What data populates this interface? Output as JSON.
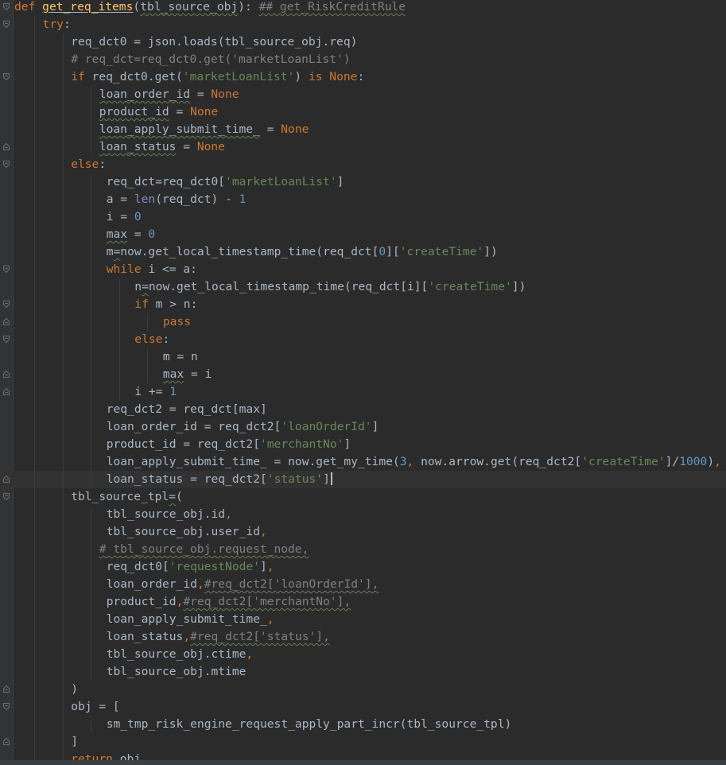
{
  "editor": {
    "language": "python",
    "colors": {
      "background": "#2b2b2b",
      "keyword": "#cc7832",
      "string": "#6a8759",
      "number": "#6897bb",
      "comment": "#808080",
      "function": "#ffc66d",
      "builtin": "#8888c6",
      "text": "#a9b7c6"
    },
    "current_line_index": 27,
    "lines": [
      {
        "indent": 0,
        "fold": "open",
        "tokens": [
          [
            "kw",
            "def "
          ],
          [
            "fn u",
            "get_req_items"
          ],
          [
            "txt",
            "("
          ],
          [
            "txt wavy",
            "tbl_source_obj"
          ],
          [
            "txt",
            "): "
          ],
          [
            "cmt wavy",
            "## get_RiskCreditRule"
          ]
        ]
      },
      {
        "indent": 1,
        "fold": "open",
        "tokens": [
          [
            "kw",
            "try"
          ],
          [
            "txt",
            ":"
          ]
        ]
      },
      {
        "indent": 2,
        "fold": "",
        "tokens": [
          [
            "txt",
            "req_dct0 = json.loads(tbl_source_obj.req)"
          ]
        ]
      },
      {
        "indent": 2,
        "fold": "",
        "tokens": [
          [
            "cmt",
            "# req_dct=req_dct0.get('marketLoanList')"
          ]
        ]
      },
      {
        "indent": 2,
        "fold": "open",
        "tokens": [
          [
            "kw",
            "if "
          ],
          [
            "txt",
            "req_dct0.get("
          ],
          [
            "str",
            "'marketLoanList'"
          ],
          [
            "txt",
            ") "
          ],
          [
            "kw",
            "is None"
          ],
          [
            "txt",
            ":"
          ]
        ]
      },
      {
        "indent": 3,
        "fold": "",
        "tokens": [
          [
            "txt wavy",
            "loan_order_id"
          ],
          [
            "txt",
            " = "
          ],
          [
            "kw",
            "None"
          ]
        ]
      },
      {
        "indent": 3,
        "fold": "",
        "tokens": [
          [
            "txt wavy",
            "product_id"
          ],
          [
            "txt",
            " = "
          ],
          [
            "kw",
            "None"
          ]
        ]
      },
      {
        "indent": 3,
        "fold": "",
        "tokens": [
          [
            "txt wavy",
            "loan_apply_submit_time_"
          ],
          [
            "txt",
            " = "
          ],
          [
            "kw",
            "None"
          ]
        ]
      },
      {
        "indent": 3,
        "fold": "end",
        "tokens": [
          [
            "txt wavy",
            "loan_status"
          ],
          [
            "txt",
            " = "
          ],
          [
            "kw",
            "None"
          ]
        ]
      },
      {
        "indent": 2,
        "fold": "open",
        "tokens": [
          [
            "kw",
            "else"
          ],
          [
            "txt",
            ":"
          ]
        ]
      },
      {
        "indent": 3.25,
        "fold": "",
        "tokens": [
          [
            "txt",
            "req_dct=req_dct0["
          ],
          [
            "str",
            "'marketLoanList'"
          ],
          [
            "txt",
            "]"
          ]
        ]
      },
      {
        "indent": 3.25,
        "fold": "",
        "tokens": [
          [
            "txt",
            "a = "
          ],
          [
            "bi",
            "len"
          ],
          [
            "txt",
            "(req_dct) - "
          ],
          [
            "num",
            "1"
          ]
        ]
      },
      {
        "indent": 3.25,
        "fold": "",
        "tokens": [
          [
            "txt",
            "i = "
          ],
          [
            "num",
            "0"
          ]
        ]
      },
      {
        "indent": 3.25,
        "fold": "",
        "tokens": [
          [
            "txt wavy",
            "max"
          ],
          [
            "txt",
            " = "
          ],
          [
            "num",
            "0"
          ]
        ]
      },
      {
        "indent": 3.25,
        "fold": "",
        "tokens": [
          [
            "txt",
            "m"
          ],
          [
            "txt wavy",
            "="
          ],
          [
            "txt",
            "now.get_local_timestamp_time(req_dct["
          ],
          [
            "num",
            "0"
          ],
          [
            "txt",
            "]["
          ],
          [
            "str",
            "'createTime'"
          ],
          [
            "txt",
            "])"
          ]
        ]
      },
      {
        "indent": 3.25,
        "fold": "open",
        "tokens": [
          [
            "kw",
            "while "
          ],
          [
            "txt",
            "i <= a:"
          ]
        ]
      },
      {
        "indent": 4.25,
        "fold": "",
        "tokens": [
          [
            "txt",
            "n"
          ],
          [
            "txt wavy",
            "="
          ],
          [
            "txt",
            "now.get_local_timestamp_time(req_dct[i]["
          ],
          [
            "str",
            "'createTime'"
          ],
          [
            "txt",
            "])"
          ]
        ]
      },
      {
        "indent": 4.25,
        "fold": "open",
        "tokens": [
          [
            "kw",
            "if "
          ],
          [
            "txt",
            "m > n:"
          ]
        ]
      },
      {
        "indent": 5.25,
        "fold": "end",
        "tokens": [
          [
            "kw",
            "pass"
          ]
        ]
      },
      {
        "indent": 4.25,
        "fold": "open",
        "tokens": [
          [
            "kw",
            "else"
          ],
          [
            "txt",
            ":"
          ]
        ]
      },
      {
        "indent": 5.25,
        "fold": "",
        "tokens": [
          [
            "txt",
            "m = n"
          ]
        ]
      },
      {
        "indent": 5.25,
        "fold": "end",
        "tokens": [
          [
            "txt wavy",
            "max"
          ],
          [
            "txt",
            " = i"
          ]
        ]
      },
      {
        "indent": 4.25,
        "fold": "end",
        "tokens": [
          [
            "txt",
            "i += "
          ],
          [
            "num",
            "1"
          ]
        ]
      },
      {
        "indent": 3.25,
        "fold": "",
        "tokens": [
          [
            "txt",
            "req_dct2 = req_dct[max]"
          ]
        ]
      },
      {
        "indent": 3.25,
        "fold": "",
        "tokens": [
          [
            "txt",
            "loan_order_id = req_dct2["
          ],
          [
            "str",
            "'loanOrderId'"
          ],
          [
            "txt",
            "]"
          ]
        ]
      },
      {
        "indent": 3.25,
        "fold": "",
        "tokens": [
          [
            "txt",
            "product_id = req_dct2["
          ],
          [
            "str",
            "'merchantNo'"
          ],
          [
            "txt",
            "]"
          ]
        ]
      },
      {
        "indent": 3.25,
        "fold": "",
        "tokens": [
          [
            "txt",
            "loan_apply_submit_time_ = now.get_my_time("
          ],
          [
            "num",
            "3"
          ],
          [
            "kw",
            ", "
          ],
          [
            "txt",
            "now.arrow.get(req_dct2["
          ],
          [
            "str",
            "'createTime'"
          ],
          [
            "txt",
            "]/"
          ],
          [
            "num",
            "1000"
          ],
          [
            "txt",
            ")"
          ],
          [
            "kw",
            ","
          ]
        ]
      },
      {
        "indent": 3.25,
        "fold": "end",
        "tokens": [
          [
            "txt",
            "loan_status = req_dct2["
          ],
          [
            "str",
            "'status'"
          ],
          [
            "txt",
            "]"
          ]
        ]
      },
      {
        "indent": 2,
        "fold": "open",
        "tokens": [
          [
            "txt",
            "tbl_source_tpl"
          ],
          [
            "txt wavy",
            "="
          ],
          [
            "txt",
            "("
          ]
        ]
      },
      {
        "indent": 3.25,
        "fold": "",
        "tokens": [
          [
            "txt",
            "tbl_source_obj.id"
          ],
          [
            "kw",
            ","
          ]
        ]
      },
      {
        "indent": 3.25,
        "fold": "",
        "tokens": [
          [
            "txt",
            "tbl_source_obj.user_id"
          ],
          [
            "kw",
            ","
          ]
        ]
      },
      {
        "indent": 3,
        "fold": "",
        "tokens": [
          [
            "cmt wavy",
            "# tbl_source_obj.request_node,"
          ]
        ]
      },
      {
        "indent": 3.25,
        "fold": "",
        "tokens": [
          [
            "txt",
            "req_dct0["
          ],
          [
            "str",
            "'requestNode'"
          ],
          [
            "txt",
            "]"
          ],
          [
            "kw",
            ","
          ]
        ]
      },
      {
        "indent": 3.25,
        "fold": "",
        "tokens": [
          [
            "txt",
            "loan_order_id"
          ],
          [
            "kw",
            ","
          ],
          [
            "cmt wavy",
            "#req_dct2['loanOrderId'],"
          ]
        ]
      },
      {
        "indent": 3.25,
        "fold": "",
        "tokens": [
          [
            "txt",
            "product_id"
          ],
          [
            "kw",
            ","
          ],
          [
            "cmt wavy",
            "#req_dct2['merchantNo'],"
          ]
        ]
      },
      {
        "indent": 3.25,
        "fold": "",
        "tokens": [
          [
            "txt",
            "loan_apply_submit_time_"
          ],
          [
            "kw",
            ","
          ]
        ]
      },
      {
        "indent": 3.25,
        "fold": "",
        "tokens": [
          [
            "txt",
            "loan_status"
          ],
          [
            "kw",
            ","
          ],
          [
            "cmt wavy",
            "#req_dct2['status'],"
          ]
        ]
      },
      {
        "indent": 3.25,
        "fold": "",
        "tokens": [
          [
            "txt",
            "tbl_source_obj.ctime"
          ],
          [
            "kw",
            ","
          ]
        ]
      },
      {
        "indent": 3.25,
        "fold": "",
        "tokens": [
          [
            "txt",
            "tbl_source_obj.mtime"
          ]
        ]
      },
      {
        "indent": 2,
        "fold": "end",
        "tokens": [
          [
            "txt",
            ")"
          ]
        ]
      },
      {
        "indent": 2,
        "fold": "open",
        "tokens": [
          [
            "txt",
            "obj = ["
          ]
        ]
      },
      {
        "indent": 3.25,
        "fold": "",
        "tokens": [
          [
            "txt",
            "sm_tmp_risk_engine_request_apply_part_incr(tbl_source_tpl)"
          ]
        ]
      },
      {
        "indent": 2,
        "fold": "end",
        "tokens": [
          [
            "txt",
            "]"
          ]
        ]
      },
      {
        "indent": 2,
        "fold": "",
        "tokens": [
          [
            "kw",
            "return "
          ],
          [
            "txt",
            "obj"
          ]
        ]
      }
    ]
  }
}
